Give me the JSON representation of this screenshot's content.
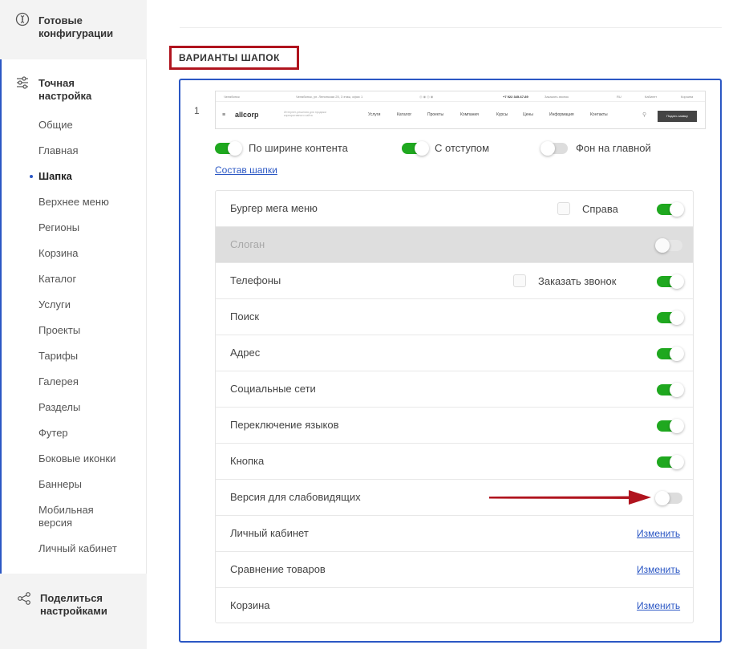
{
  "sidebar": {
    "ready_configs": "Готовые конфигурации",
    "fine_tuning": "Точная настройка",
    "share": "Поделиться настройками",
    "items": [
      {
        "label": "Общие",
        "active": false
      },
      {
        "label": "Главная",
        "active": false
      },
      {
        "label": "Шапка",
        "active": true
      },
      {
        "label": "Верхнее меню",
        "active": false
      },
      {
        "label": "Регионы",
        "active": false
      },
      {
        "label": "Корзина",
        "active": false
      },
      {
        "label": "Каталог",
        "active": false
      },
      {
        "label": "Услуги",
        "active": false
      },
      {
        "label": "Проекты",
        "active": false
      },
      {
        "label": "Тарифы",
        "active": false
      },
      {
        "label": "Галерея",
        "active": false
      },
      {
        "label": "Разделы",
        "active": false
      },
      {
        "label": "Футер",
        "active": false
      },
      {
        "label": "Боковые иконки",
        "active": false
      },
      {
        "label": "Баннеры",
        "active": false
      },
      {
        "label": "Мобильная версия",
        "active": false
      },
      {
        "label": "Личный кабинет",
        "active": false
      }
    ]
  },
  "main": {
    "section_title": "ВАРИАНТЫ ШАПОК",
    "variant_number": "1",
    "preview": {
      "region": "Челябинск",
      "address": "Челябинск, ул. Ленинская 25, 3 этаж, офис 1",
      "phone": "+7 922 345-67-89",
      "callback": "Заказать звонок",
      "lang": "RU",
      "cabinet": "Кабинет",
      "cart": "Корзина",
      "logo": "allcorp",
      "tagline": "Интернет-решения для продажи корпоративного сайта",
      "nav": [
        "Услуги",
        "Каталог",
        "Проекты",
        "Компания",
        "Курсы",
        "Цены",
        "Информация",
        "Контакты"
      ],
      "button": "Подать заявку"
    },
    "options": {
      "content_width": {
        "label": "По ширине контента",
        "on": true
      },
      "with_margin": {
        "label": "С отступом",
        "on": true
      },
      "home_bg": {
        "label": "Фон на главной",
        "on": false
      }
    },
    "composition_link": "Состав шапки",
    "rows": [
      {
        "label": "Бургер мега меню",
        "checkbox": "Справа",
        "toggle": "on"
      },
      {
        "label": "Слоган",
        "toggle": "disabled"
      },
      {
        "label": "Телефоны",
        "checkbox": "Заказать звонок",
        "toggle": "on"
      },
      {
        "label": "Поиск",
        "toggle": "on"
      },
      {
        "label": "Адрес",
        "toggle": "on"
      },
      {
        "label": "Социальные сети",
        "toggle": "on"
      },
      {
        "label": "Переключение языков",
        "toggle": "on"
      },
      {
        "label": "Кнопка",
        "toggle": "on"
      },
      {
        "label": "Версия для слабовидящих",
        "toggle": "off"
      },
      {
        "label": "Личный кабинет",
        "link": "Изменить"
      },
      {
        "label": "Сравнение товаров",
        "link": "Изменить"
      },
      {
        "label": "Корзина",
        "link": "Изменить"
      }
    ]
  },
  "colors": {
    "accent": "#2b57c4",
    "toggle_on": "#1fa81f",
    "highlight_red": "#b0141e"
  }
}
